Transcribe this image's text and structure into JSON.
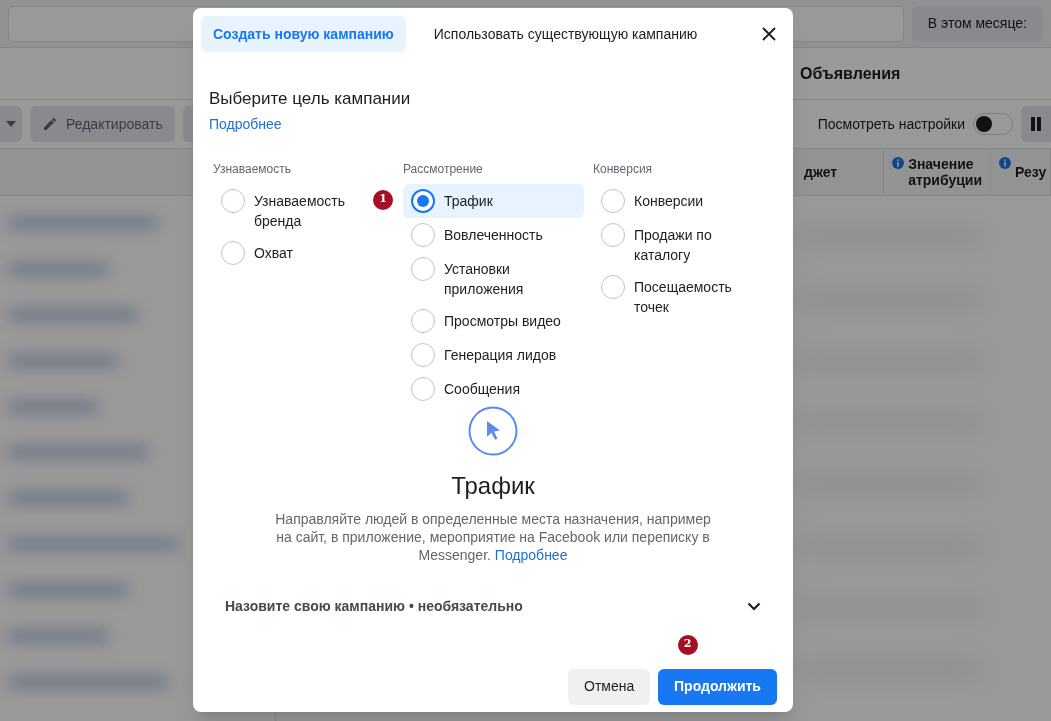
{
  "background": {
    "period_button": "В этом месяце:",
    "section_tab": "Объявления",
    "edit_button": "Редактировать",
    "view_settings": {
      "label": "Посмотреть настройки",
      "on": false
    },
    "table_columns": [
      {
        "label": "джет",
        "info": false
      },
      {
        "label": "Значение атрибуции",
        "info": true
      },
      {
        "label": "Резу",
        "info": true
      }
    ]
  },
  "dialog": {
    "tabs": [
      {
        "label": "Создать новую кампанию",
        "selected": true
      },
      {
        "label": "Использовать существующую кампанию",
        "selected": false
      }
    ],
    "heading": "Выберите цель кампании",
    "learn_more": "Подробнее",
    "columns": [
      {
        "title": "Узнаваемость",
        "options": [
          {
            "label": "Узнаваемость бренда",
            "selected": false
          },
          {
            "label": "Охват",
            "selected": false
          }
        ]
      },
      {
        "title": "Рассмотрение",
        "options": [
          {
            "label": "Трафик",
            "selected": true
          },
          {
            "label": "Вовлеченность",
            "selected": false
          },
          {
            "label": "Установки приложения",
            "selected": false
          },
          {
            "label": "Просмотры видео",
            "selected": false
          },
          {
            "label": "Генерация лидов",
            "selected": false
          },
          {
            "label": "Сообщения",
            "selected": false
          }
        ]
      },
      {
        "title": "Конверсия",
        "options": [
          {
            "label": "Конверсии",
            "selected": false
          },
          {
            "label": "Продажи по каталогу",
            "selected": false
          },
          {
            "label": "Посещаемость точек",
            "selected": false
          }
        ]
      }
    ],
    "step_badges": [
      "1",
      "2"
    ],
    "preview": {
      "title": "Трафик",
      "description": "Направляйте людей в определенные места назначения, например на сайт, в приложение, мероприятие на Facebook или переписку в Messenger.",
      "link": "Подробнее"
    },
    "name_section": {
      "label": "Назовите свою кампанию • необязательно",
      "expanded": false
    },
    "buttons": [
      {
        "label": "Отмена",
        "kind": "secondary"
      },
      {
        "label": "Продолжить",
        "kind": "primary"
      }
    ]
  }
}
